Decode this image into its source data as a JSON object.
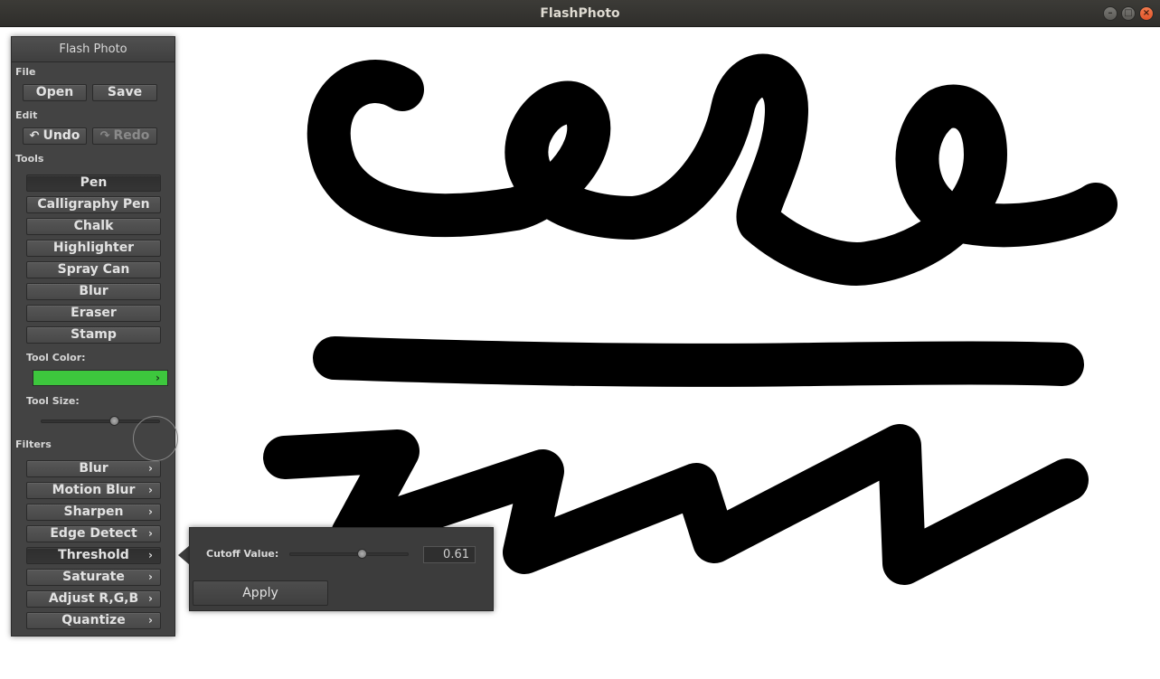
{
  "window": {
    "title": "FlashPhoto",
    "min_glyph": "–",
    "max_glyph": "□",
    "close_glyph": "×"
  },
  "panel": {
    "title": "Flash Photo",
    "file": {
      "label": "File",
      "open": "Open",
      "save": "Save"
    },
    "edit": {
      "label": "Edit",
      "undo": "Undo",
      "redo": "Redo",
      "undo_icon": "↶",
      "redo_icon": "↷"
    },
    "tools": {
      "label": "Tools",
      "items": [
        "Pen",
        "Calligraphy Pen",
        "Chalk",
        "Highlighter",
        "Spray Can",
        "Blur",
        "Eraser",
        "Stamp"
      ],
      "selected": "Pen"
    },
    "tool_color": {
      "label": "Tool Color:",
      "value": "#3dc73d"
    },
    "tool_size": {
      "label": "Tool Size:",
      "value_fraction": 0.62
    },
    "filters": {
      "label": "Filters",
      "items": [
        "Blur",
        "Motion Blur",
        "Sharpen",
        "Edge Detect",
        "Threshold",
        "Saturate",
        "Adjust R,G,B",
        "Quantize"
      ],
      "selected": "Threshold"
    }
  },
  "threshold_popover": {
    "cutoff_label": "Cutoff Value:",
    "cutoff_value": "0.61",
    "cutoff_fraction": 0.61,
    "apply_label": "Apply"
  },
  "icons": {
    "chevron": "›"
  },
  "colors": {
    "panel_bg": "#434343",
    "canvas_bg": "#ffffff",
    "stroke": "#000000",
    "tool_color": "#3dc73d"
  }
}
